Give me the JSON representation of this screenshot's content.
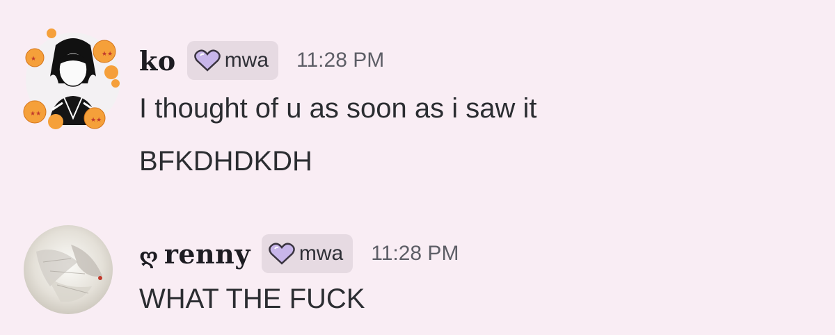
{
  "messages": [
    {
      "author": "ko",
      "tag_label": "mwa",
      "timestamp": "11:28 PM",
      "lines": [
        "I thought of u as soon as i saw it",
        "BFKDHDKDH"
      ]
    },
    {
      "author": "renny",
      "author_prefix": "ღ",
      "tag_label": "mwa",
      "timestamp": "11:28 PM",
      "lines": [
        "WHAT THE FUCK"
      ]
    }
  ],
  "colors": {
    "background": "#f9edf4",
    "tag_background": "#e6dae2",
    "heart_fill": "#c8b6ea",
    "dragon_ball": "#f5a03a"
  },
  "icons": {
    "tag_icon": "heart-icon",
    "avatar_decoration": "dragon-ball-icon"
  }
}
